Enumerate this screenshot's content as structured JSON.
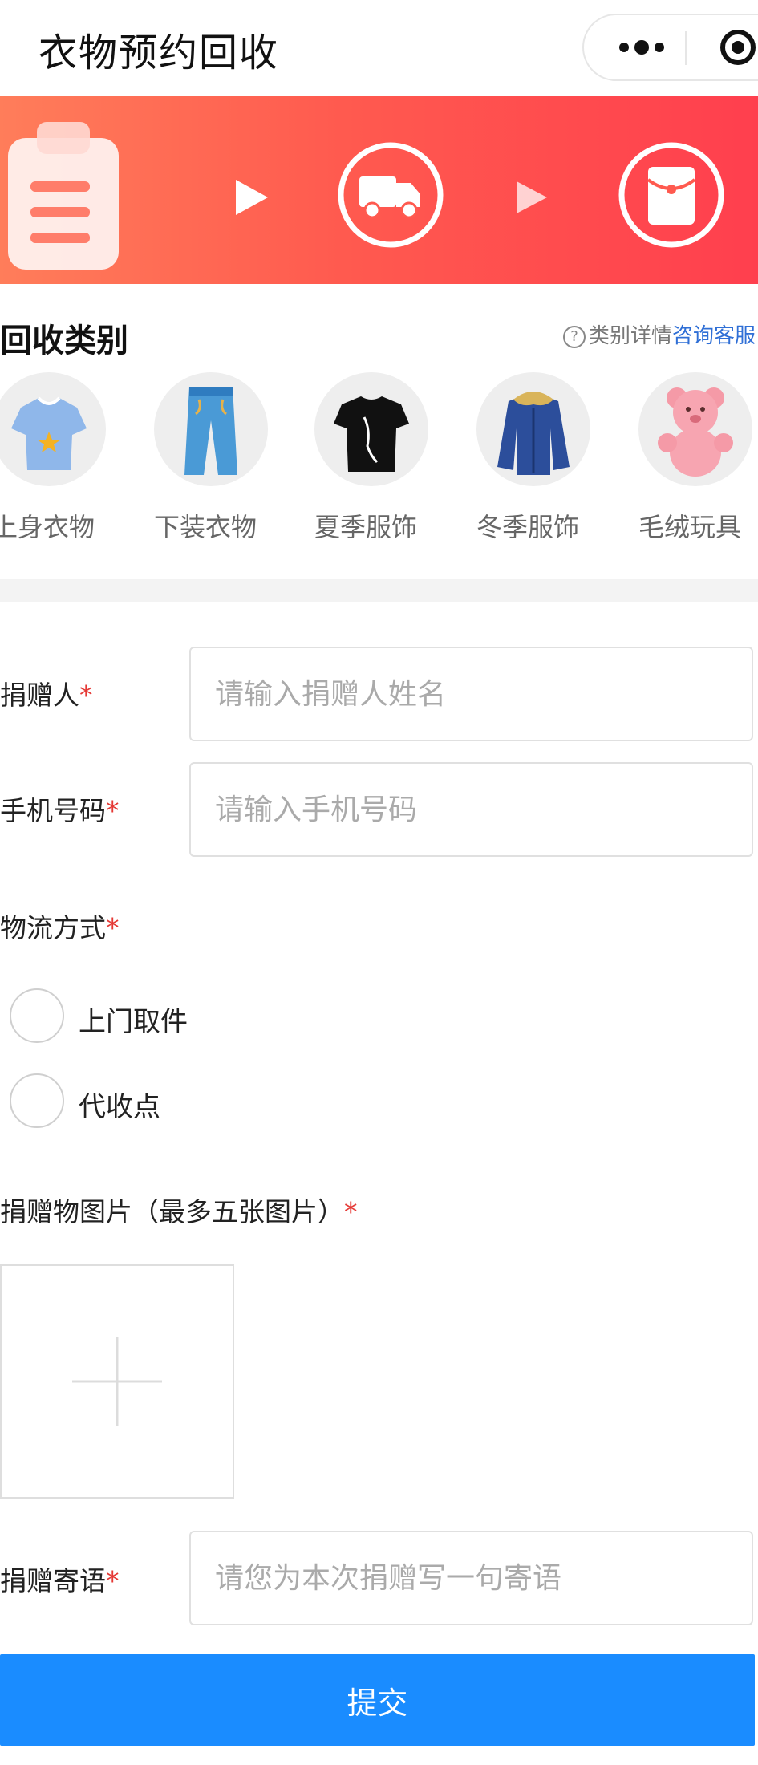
{
  "header": {
    "title": "衣物预约回收",
    "more_icon": "more-dots-icon",
    "close_icon": "target-circle-icon"
  },
  "banner": {
    "steps": [
      "clipboard-icon",
      "play-arrow-icon",
      "truck-icon",
      "play-arrow-icon",
      "red-envelope-icon"
    ],
    "gradient_start": "#ff7d5a",
    "gradient_end": "#ff3f4e"
  },
  "category": {
    "title": "回收类别",
    "help_symbol": "?",
    "help_text": "类别详情",
    "consult_text": "咨询客服",
    "items": [
      {
        "label": "上身衣物",
        "icon": "tshirt-icon"
      },
      {
        "label": "下装衣物",
        "icon": "jeans-icon"
      },
      {
        "label": "夏季服饰",
        "icon": "summer-shirt-icon"
      },
      {
        "label": "冬季服饰",
        "icon": "winter-jacket-icon"
      },
      {
        "label": "毛绒玩具",
        "icon": "teddy-bear-icon"
      }
    ]
  },
  "form": {
    "required_mark": "*",
    "donor": {
      "label": "捐赠人",
      "placeholder": "请输入捐赠人姓名",
      "value": ""
    },
    "phone": {
      "label": "手机号码",
      "placeholder": "请输入手机号码",
      "value": ""
    },
    "logistics": {
      "label": "物流方式",
      "options": [
        "上门取件",
        "代收点"
      ]
    },
    "photos": {
      "label": "捐赠物图片（最多五张图片）",
      "upload_icon": "plus-icon"
    },
    "message": {
      "label": "捐赠寄语",
      "placeholder": "请您为本次捐赠写一句寄语",
      "value": ""
    }
  },
  "submit": {
    "label": "提交",
    "color": "#1a8cff"
  }
}
